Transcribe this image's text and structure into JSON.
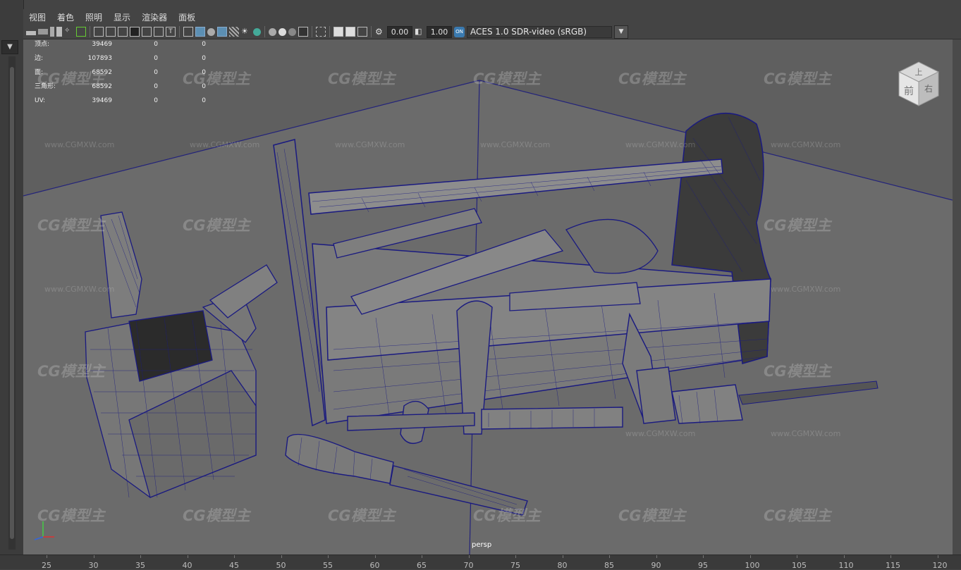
{
  "menu": [
    "视图",
    "着色",
    "照明",
    "显示",
    "渲染器",
    "面板"
  ],
  "toolbar": {
    "value_a": "0.00",
    "value_b": "1.00",
    "color_badge": "ON",
    "color_space": "ACES 1.0 SDR-video (sRGB)"
  },
  "stats": [
    {
      "label": "顶点:",
      "v1": "39469",
      "v2": "0",
      "v3": "0"
    },
    {
      "label": "边:",
      "v1": "107893",
      "v2": "0",
      "v3": "0"
    },
    {
      "label": "面:",
      "v1": "68592",
      "v2": "0",
      "v3": "0"
    },
    {
      "label": "三角形:",
      "v1": "68592",
      "v2": "0",
      "v3": "0"
    },
    {
      "label": "UV:",
      "v1": "39469",
      "v2": "0",
      "v3": "0"
    }
  ],
  "camera": "persp",
  "viewcube": {
    "top": "上",
    "front": "前",
    "right": "右"
  },
  "watermark": {
    "logo": "CG模型主",
    "url": "www.CGMXW.com"
  },
  "timeline": [
    "25",
    "30",
    "35",
    "40",
    "45",
    "50",
    "55",
    "60",
    "65",
    "70",
    "75",
    "80",
    "85",
    "90",
    "95",
    "100",
    "105",
    "110",
    "115",
    "120"
  ],
  "colors": {
    "viewport_bg": "#6b6b6b",
    "wire": "#1a1a80",
    "ui_bg": "#444444",
    "highlight": "#5c8fb3"
  }
}
